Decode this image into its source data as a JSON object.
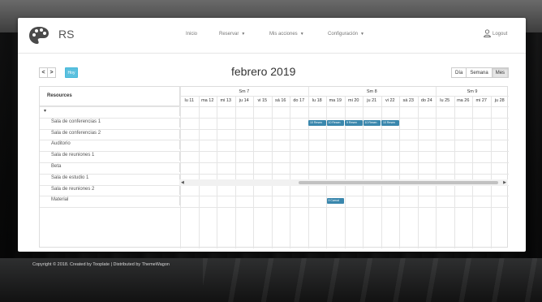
{
  "app": {
    "brand": "RS"
  },
  "nav": {
    "items": [
      {
        "label": "Inicio",
        "caret": false
      },
      {
        "label": "Reservar",
        "caret": true
      },
      {
        "label": "Mis acciones",
        "caret": true
      },
      {
        "label": "Configuración",
        "caret": true
      }
    ],
    "logout": "Logout"
  },
  "toolbar": {
    "prev": "<",
    "next": ">",
    "today": "Hoy",
    "title": "febrero 2019",
    "views": [
      "Día",
      "Semana",
      "Mes"
    ],
    "active_view": "Mes"
  },
  "scheduler": {
    "resources_header": "Resources",
    "weeks": [
      "Sm 7",
      "Sm 8",
      "Sm 9"
    ],
    "days": [
      "lu 11",
      "ma 12",
      "mi 13",
      "ju 14",
      "vi 15",
      "sá 16",
      "do 17",
      "lu 18",
      "ma 19",
      "mi 20",
      "ju 21",
      "vi 22",
      "sá 23",
      "do 24",
      "lu 25",
      "ma 26",
      "mi 27",
      "ju 28"
    ],
    "group_toggle": "▾",
    "resources": [
      "Sala de conferencias 1",
      "Sala de conferencias 2",
      "Auditorio",
      "Sala de reuniones 1",
      "Beta",
      "Sala de estudio 1",
      "Sala de reuniones 2",
      "Material"
    ],
    "events": [
      {
        "resource": "Sala de conferencias 1",
        "day": "lu 18",
        "label": "10 Resen"
      },
      {
        "resource": "Sala de conferencias 1",
        "day": "ma 19",
        "label": "10 Resen"
      },
      {
        "resource": "Sala de conferencias 1",
        "day": "mi 20",
        "label": "9 Resen"
      },
      {
        "resource": "Sala de conferencias 1",
        "day": "ju 21",
        "label": "10 Resen"
      },
      {
        "resource": "Sala de conferencias 1",
        "day": "vi 22",
        "label": "10 Resen"
      },
      {
        "resource": "Material",
        "day": "ma 19",
        "label": "9 Carrod"
      }
    ],
    "event_color": "#3a87ad"
  },
  "footer": {
    "text": "Copyright © 2018. Created by Tooplate | Distributed by ThemeWagon"
  }
}
